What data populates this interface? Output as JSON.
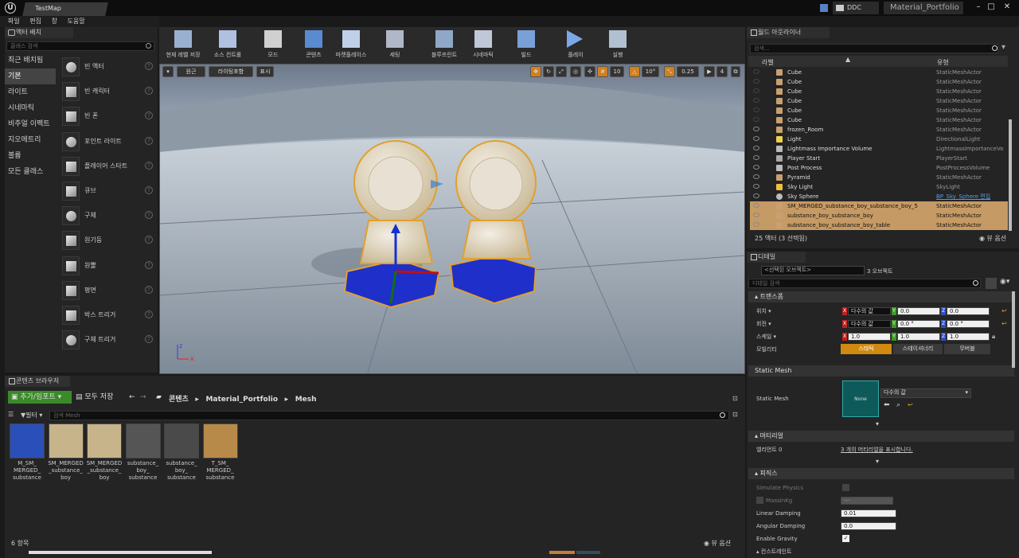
{
  "app": {
    "map_tab": "TestMap",
    "project_name": "Material_Portfolio",
    "ddc_label": "DDC"
  },
  "menu": [
    "파일",
    "편집",
    "창",
    "도움말"
  ],
  "modes": {
    "tab": "액터 배치",
    "search_placeholder": "클래스 검색",
    "categories": [
      "최근 배치됨",
      "기본",
      "라이트",
      "시네마틱",
      "비주얼 이펙트",
      "지오메트리",
      "볼륨",
      "모든 클래스"
    ],
    "selected_category": "기본",
    "items": [
      "빈 액터",
      "빈 캐릭터",
      "빈 폰",
      "포인트 라이트",
      "플레이어 스타트",
      "큐브",
      "구체",
      "원기둥",
      "원뿔",
      "평면",
      "박스 트리거",
      "구체 트리거"
    ],
    "help": "?"
  },
  "toolbar": [
    "현재 레벨 저장",
    "소스 컨트롤",
    "모드",
    "콘텐츠",
    "마켓플레이스",
    "세팅",
    "블루프린트",
    "시네마틱",
    "빌드",
    "플레이",
    "실행"
  ],
  "viewport": {
    "view_mode": "원근",
    "lighting": "라이팅포함",
    "show": "표시",
    "grid_snap": "10",
    "rot_snap": "10°",
    "scale_snap": "0.25",
    "camera_speed": "4",
    "axis_x": "x",
    "axis_z": "z"
  },
  "outliner": {
    "tab": "월드 아웃라이너",
    "search_placeholder": "검색...",
    "col_label": "라벨",
    "col_type": "유형",
    "rows": [
      {
        "name": "Cube",
        "type": "StaticMeshActor",
        "eye": false,
        "sel": false
      },
      {
        "name": "Cube",
        "type": "StaticMeshActor",
        "eye": false,
        "sel": false
      },
      {
        "name": "Cube",
        "type": "StaticMeshActor",
        "eye": false,
        "sel": false
      },
      {
        "name": "Cube",
        "type": "StaticMeshActor",
        "eye": false,
        "sel": false
      },
      {
        "name": "Cube",
        "type": "StaticMeshActor",
        "eye": false,
        "sel": false
      },
      {
        "name": "Cube",
        "type": "StaticMeshActor",
        "eye": false,
        "sel": false
      },
      {
        "name": "frozen_Room",
        "type": "StaticMeshActor",
        "eye": true,
        "sel": false
      },
      {
        "name": "Light",
        "type": "DirectionalLight",
        "eye": true,
        "sel": false
      },
      {
        "name": "Lightmass Importance Volume",
        "type": "LightmassImportanceVo",
        "eye": true,
        "sel": false
      },
      {
        "name": "Player Start",
        "type": "PlayerStart",
        "eye": true,
        "sel": false
      },
      {
        "name": "Post Process",
        "type": "PostProcessVolume",
        "eye": true,
        "sel": false
      },
      {
        "name": "Pyramid",
        "type": "StaticMeshActor",
        "eye": true,
        "sel": false
      },
      {
        "name": "Sky Light",
        "type": "SkyLight",
        "eye": true,
        "sel": false
      },
      {
        "name": "Sky Sphere",
        "type": "BP_Sky_Sphere 편집",
        "eye": true,
        "sel": false,
        "link": true
      },
      {
        "name": "SM_MERGED_substance_boy_substance_boy_5",
        "type": "StaticMeshActor",
        "eye": true,
        "sel": true
      },
      {
        "name": "substance_boy_substance_boy",
        "type": "StaticMeshActor",
        "eye": true,
        "sel": true
      },
      {
        "name": "substance_boy_substance_boy_table",
        "type": "StaticMeshActor",
        "eye": true,
        "sel": true
      }
    ],
    "status": "25 액터 (3 선택됨)",
    "view_options": "뷰 옵션"
  },
  "details": {
    "tab": "디테일",
    "selected_box": "<선택된 오브젝트>",
    "object_count": "3 오브젝트",
    "search_placeholder": "디테일 검색",
    "transform_header": "트랜스폼",
    "location_label": "위치",
    "rotation_label": "회전",
    "scale_label": "스케일",
    "mobility_label": "모빌리티",
    "location": [
      "다수의 값",
      "0.0",
      "0.0"
    ],
    "rotation": [
      "다수의 값",
      "0.0 °",
      "0.0 °"
    ],
    "scale": [
      "1.0",
      "1.0",
      "1.0"
    ],
    "mobility": [
      "스태틱",
      "스테이셔너리",
      "무버블"
    ],
    "static_mesh_header": "Static Mesh",
    "static_mesh_label": "Static Mesh",
    "static_mesh_thumb": "None",
    "static_mesh_value": "다수의 값",
    "materials_header": "머티리얼",
    "element_label": "엘리먼트 0",
    "element_value": "3 개의 머티리얼을 표시합니다.",
    "physics_header": "피직스",
    "physics": [
      {
        "label": "Simulate Physics",
        "value": ""
      },
      {
        "label": "MassInKg",
        "value": "---"
      },
      {
        "label": "Linear Damping",
        "value": "0.01"
      },
      {
        "label": "Angular Damping",
        "value": "0.0"
      },
      {
        "label": "Enable Gravity",
        "value": "✓"
      }
    ],
    "next_header": "컨스트레인트"
  },
  "content_browser": {
    "tab": "콘텐츠 브라우저",
    "add_import": "추가/임포트",
    "save_all": "모두 저장",
    "path": [
      "콘텐츠",
      "Material_Portfolio",
      "Mesh"
    ],
    "filters": "필터",
    "search_placeholder": "검색 Mesh",
    "assets": [
      {
        "name": "M_SM_ MERGED_ substance",
        "color": "#2a4fb8"
      },
      {
        "name": "SM_MERGED _substance_ boy",
        "color": "#c8b48a"
      },
      {
        "name": "SM_MERGED _substance_ boy",
        "color": "#c8b48a"
      },
      {
        "name": "substance_ boy_ substance",
        "color": "#555555"
      },
      {
        "name": "substance_ boy_ substance",
        "color": "#4a4a4a"
      },
      {
        "name": "T_SM_ MERGED_ substance",
        "color": "#b88a4a"
      }
    ],
    "count": "6 항목",
    "view_options": "뷰 옵션"
  }
}
